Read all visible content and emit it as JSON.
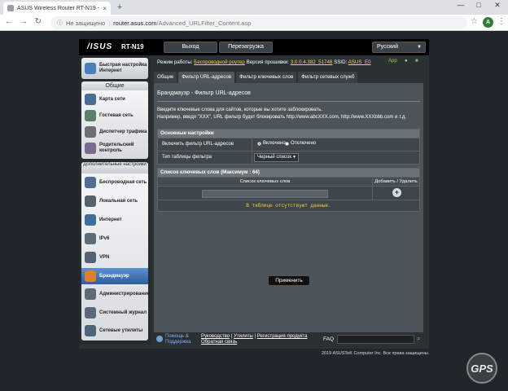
{
  "browser": {
    "tab_title": "ASUS Wireless Router RT-N19 - ",
    "tab_close": "×",
    "new_tab": "+",
    "win_min": "—",
    "win_max": "□",
    "win_close": "✕",
    "back": "←",
    "forward": "→",
    "reload": "↻",
    "security_label": "Не защищено",
    "url_host": "router.asus.com",
    "url_path": "/Advanced_URLFilter_Content.asp",
    "star": "☆",
    "profile_initial": "A",
    "menu": "⋮"
  },
  "router": {
    "logo": "/ISUS",
    "model": "RT-N19",
    "logout": "Выход",
    "reboot": "Перезагрузка",
    "language": "Русский",
    "status": {
      "mode_label": "Режим работы:",
      "mode_value": "Беспроводной роутер",
      "fw_label": "Версия прошивки:",
      "fw_value": "3.0.0.4.382_51748",
      "ssid_label": "SSID:",
      "ssid_value": "ASUS_E0",
      "app_label": "App"
    },
    "nav": {
      "quick_setup": "Быстрая настройка Интернет",
      "general_header": "Общие",
      "general": [
        "Карта сети",
        "Гостевая сеть",
        "Диспетчер трафика",
        "Родительский контроль"
      ],
      "advanced_header": "Дополнительные настройки",
      "advanced": [
        "Беспроводная сеть",
        "Локальная сеть",
        "Интернет",
        "IPv6",
        "VPN",
        "Брандмауэр",
        "Администрирование",
        "Системный журнал",
        "Сетевые утилиты"
      ]
    },
    "tabs": [
      "Общие",
      "Фильтр URL-адресов",
      "Фильтр ключевых слов",
      "Фильтр сетевых служб"
    ],
    "panel": {
      "title": "Брандмауэр - Фильтр URL-адресов",
      "desc_line1": "Введите ключевые слова для сайтов, которые вы хотите заблокировать.",
      "desc_line2": "Например, введя \"XXX\", URL фильтр будет блокировать http://www.abcXXX.com, http://www.XXXbbb.com и т.д.",
      "basic_header": "Основные настройки",
      "enable_label": "Включить фильтр URL-адресов",
      "enabled": "Включено",
      "disabled": "Отключено",
      "table_type_label": "Тип таблицы фильтра",
      "table_type_value": "Черный список",
      "list_header": "Список ключевых слов (Максимум : 64)",
      "col_keyword": "Список ключевых слов",
      "col_add": "Добавить / Удалить",
      "add_symbol": "+",
      "empty": "В таблице отсутствуют данные.",
      "apply": "Применить"
    },
    "footer": {
      "help": "Помощь & Поддержка",
      "manual": "Руководство",
      "utilities": "Утилиты",
      "registration": "Регистрация продукта",
      "feedback": "Обратная связь",
      "faq": "FAQ",
      "go": "⌕"
    },
    "copyright": "2019 ASUSTeK Computer Inc. Все права защищены."
  },
  "colors": {
    "accent": "#2f5f9b",
    "warning_text": "#ffcc33",
    "link": "#7db3ff"
  }
}
